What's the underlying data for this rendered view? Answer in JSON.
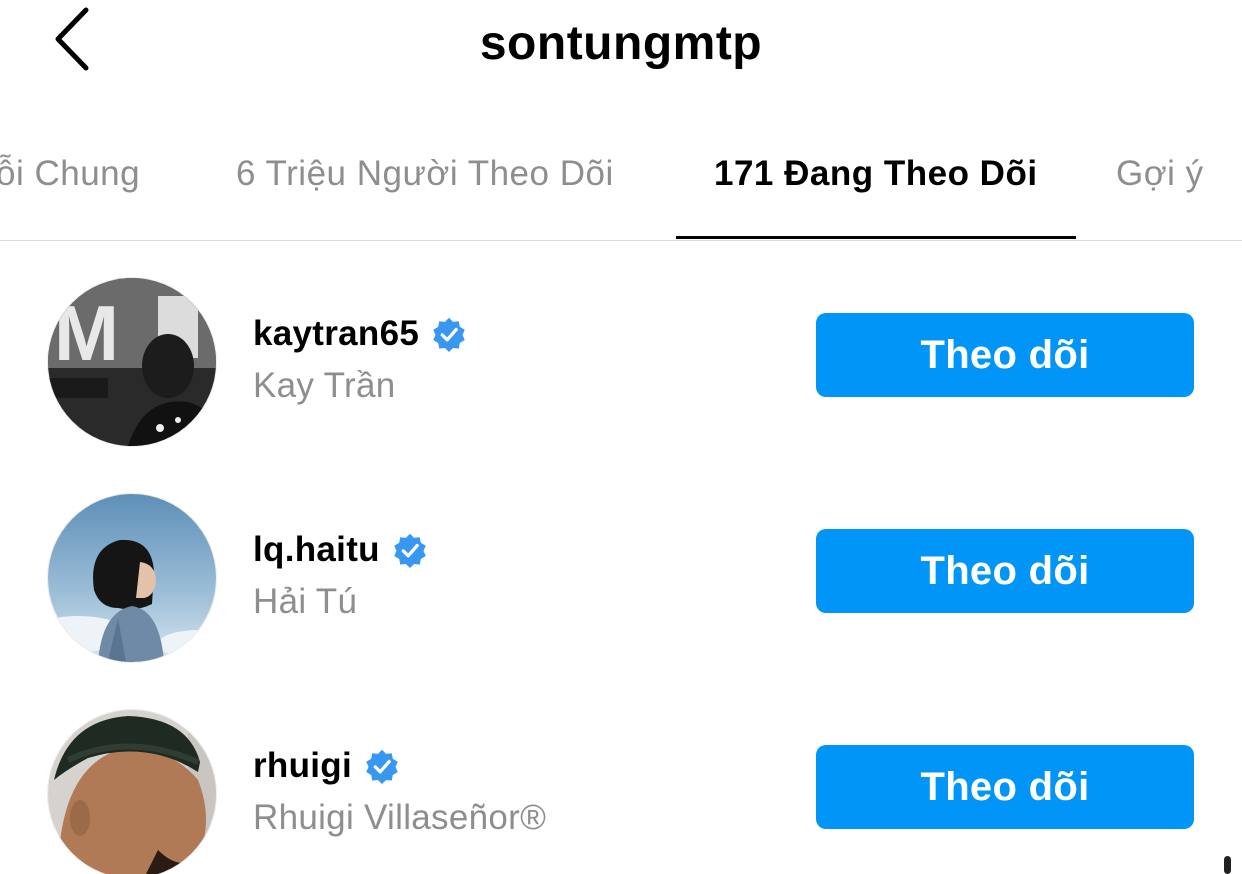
{
  "header": {
    "title": "sontungmtp",
    "back_icon": "chevron-left-icon"
  },
  "tabs": [
    {
      "label": "Người Theo Dõi Chung",
      "visible_label": "ỗi Chung",
      "active": false
    },
    {
      "label": "6 Triệu Người Theo Dõi",
      "active": false
    },
    {
      "label": "171 Đang Theo Dõi",
      "active": true
    },
    {
      "label": "Gợi ý",
      "active": false
    }
  ],
  "accounts": [
    {
      "username": "kaytran65",
      "full_name": "Kay Trần",
      "verified": true,
      "button": "Theo dõi"
    },
    {
      "username": "lq.haitu",
      "full_name": "Hải Tú",
      "verified": true,
      "button": "Theo dõi"
    },
    {
      "username": "rhuigi",
      "full_name": "Rhuigi Villaseñor®",
      "verified": true,
      "button": "Theo dõi"
    }
  ],
  "colors": {
    "accent": "#0095f6",
    "verified": "#3897f0",
    "muted_text": "#8e8e8e"
  }
}
